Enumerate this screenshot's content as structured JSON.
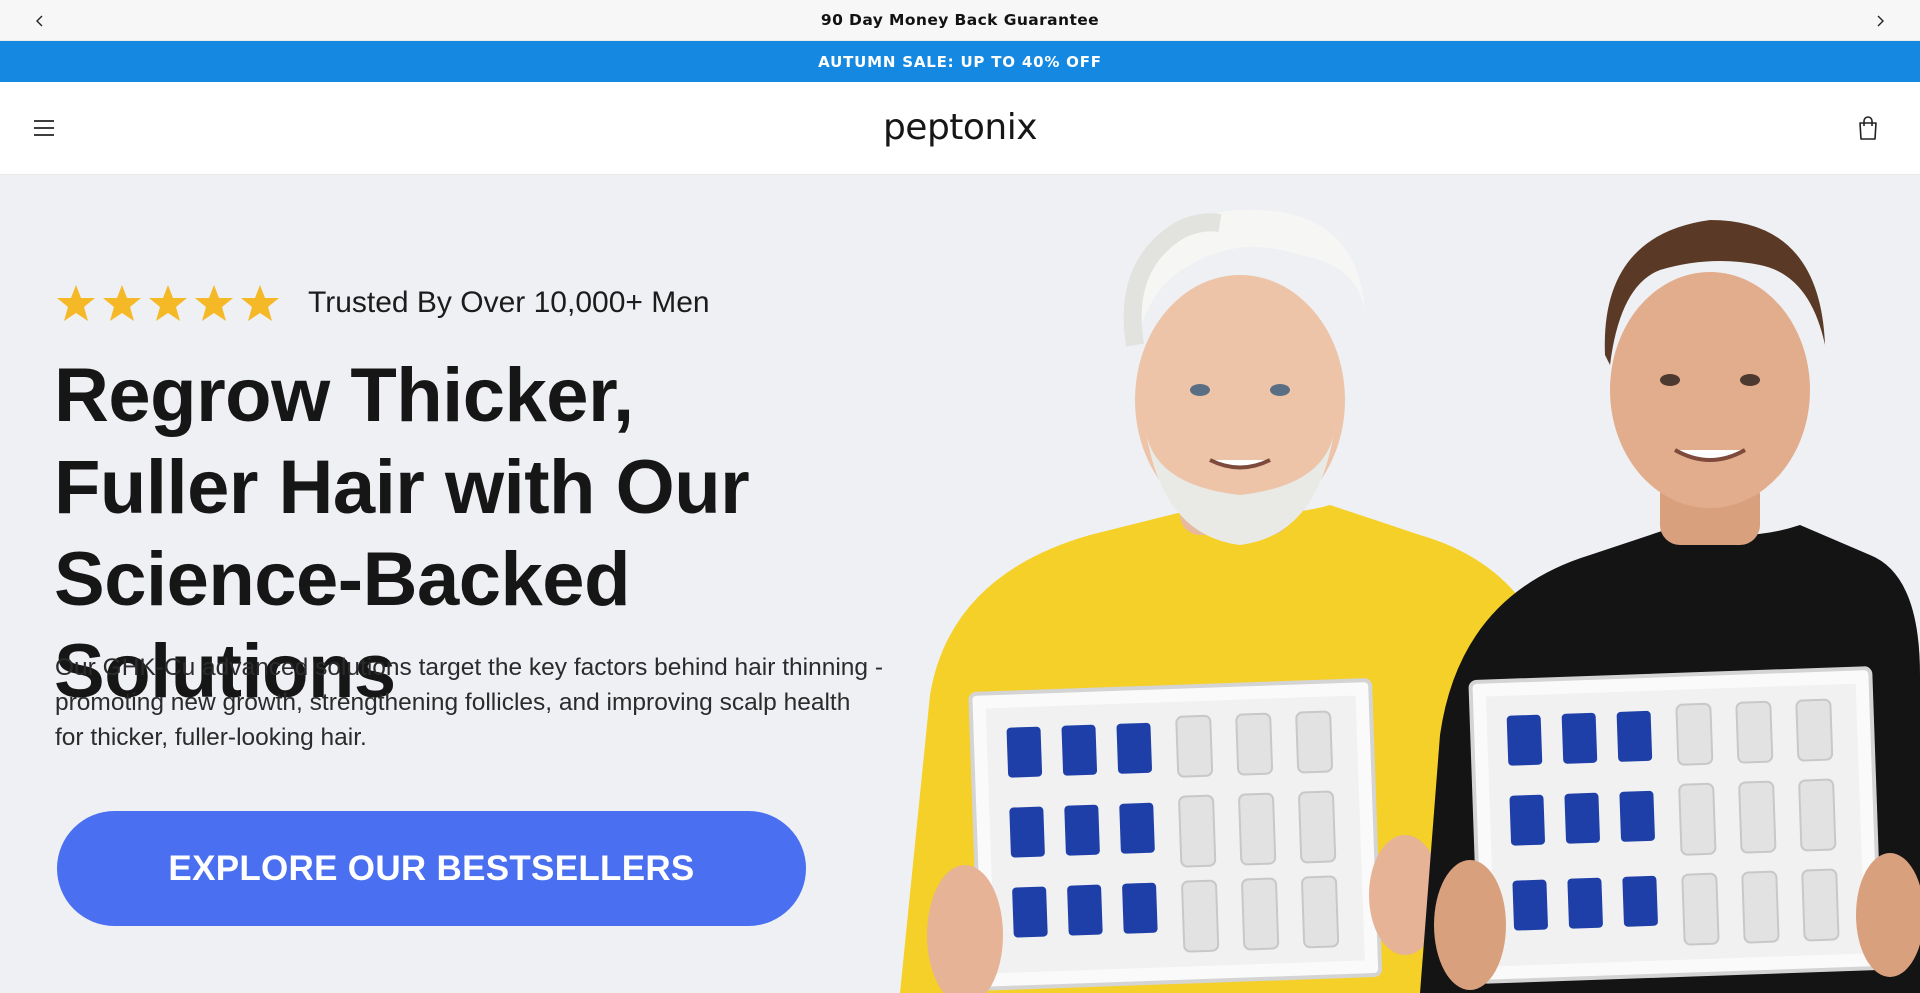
{
  "announcement": {
    "text": "90 Day Money Back Guarantee",
    "prev_icon": "chevron-left-icon",
    "next_icon": "chevron-right-icon"
  },
  "sale_bar": {
    "text": "AUTUMN SALE: UP TO 40% OFF",
    "background": "#1589e2"
  },
  "header": {
    "logo_text": "peptonix",
    "menu_icon": "hamburger-menu-icon",
    "cart_icon": "shopping-bag-icon"
  },
  "hero": {
    "rating": {
      "stars": 5,
      "star_color": "#f5b826",
      "text": "Trusted By Over 10,000+ Men"
    },
    "headline": {
      "part1": "Regrow ",
      "part2_bold": "Thicker,",
      "part3_bold": "Fuller Hair",
      "part4": " with Our",
      "part5": "Science-Backed Solutions"
    },
    "subtext": "Our GHK-Cu advanced solutions target the key factors behind hair thinning - promoting new growth, strengthening follicles, and improving scalp health for thicker, fuller-looking hair.",
    "cta_label": "EXPLORE OUR BESTSELLERS",
    "cta_color": "#4a6ff0",
    "image_alt": "two-men-holding-serum-kits"
  }
}
